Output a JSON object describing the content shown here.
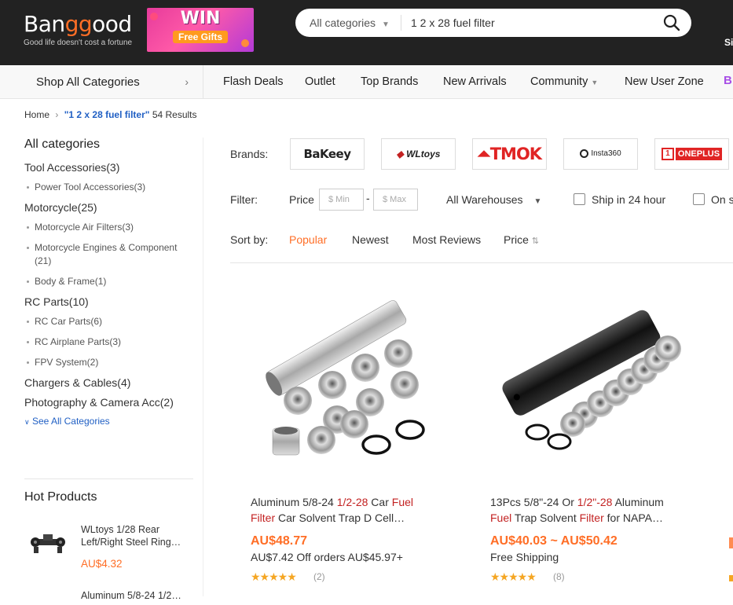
{
  "header": {
    "logo_text_a": "Ban",
    "logo_text_b": "gg",
    "logo_text_c": "ood",
    "logo_tagline": "Good life doesn't cost a fortune",
    "promo_win": "WIN",
    "promo_gifts": "Free Gifts",
    "search_category": "All categories",
    "search_query": "1 2 x 28 fuel filter",
    "sign_partial": "Si"
  },
  "nav": {
    "shop_all": "Shop All Categories",
    "links": [
      "Flash Deals",
      "Outlet",
      "Top Brands",
      "New Arrivals",
      "Community",
      "New User Zone"
    ],
    "partial": "B"
  },
  "breadcrumb": {
    "home": "Home",
    "query": "\"1 2 x 28 fuel filter\"",
    "count": "54 Results"
  },
  "sidebar": {
    "title": "All categories",
    "cat1": "Tool Accessories(3)",
    "cat1_sub1": "Power Tool Accessories(3)",
    "cat2": "Motorcycle(25)",
    "cat2_sub1": "Motorcycle Air Filters(3)",
    "cat2_sub2": "Motorcycle Engines & Component (21)",
    "cat2_sub3": "Body & Frame(1)",
    "cat3": "RC Parts(10)",
    "cat3_sub1": "RC Car Parts(6)",
    "cat3_sub2": "RC Airplane Parts(3)",
    "cat3_sub3": "FPV System(2)",
    "cat4": "Chargers & Cables(4)",
    "cat5": "Photography & Camera Acc(2)",
    "see_all": "See All Categories",
    "hot_title": "Hot Products",
    "hot1_name": "WLtoys 1/28 Rear Left/Right Steel Ring…",
    "hot1_price": "AU$4.32",
    "hot2_name": "Aluminum 5/8-24 1/2…"
  },
  "filters": {
    "brands_label": "Brands:",
    "brands": [
      "BaKeey",
      "WLtoys",
      "TMOK",
      "Insta360",
      "ONEPLUS"
    ],
    "filter_label": "Filter:",
    "price_label": "Price",
    "min_placeholder": "$ Min",
    "max_placeholder": "$ Max",
    "dash": "-",
    "warehouse": "All Warehouses",
    "ship24": "Ship in 24 hour",
    "onsale_partial": "On s",
    "sort_label": "Sort by:",
    "sort_options": [
      "Popular",
      "Newest",
      "Most Reviews",
      "Price"
    ]
  },
  "products": [
    {
      "title_a": "Aluminum 5/8-24 ",
      "title_hl1": "1/2-28",
      "title_b": " Car ",
      "title_hl2": "Fuel Filter",
      "title_c": " Car Solvent Trap D Cell…",
      "price": "AU$48.77",
      "promo": "AU$7.42 Off orders AU$45.97+",
      "stars": "★★★★★",
      "reviews": "(2)"
    },
    {
      "title_a": "13Pcs 5/8\"-24 Or ",
      "title_hl1": "1/2\"-28",
      "title_b": " Aluminum ",
      "title_hl2": "Fuel",
      "title_c": " Trap Solvent ",
      "title_hl3": "Filter",
      "title_d": " for NAPA…",
      "price": "AU$40.03 ~ AU$50.42",
      "promo": "Free Shipping",
      "stars": "★★★★★",
      "reviews": "(8)"
    }
  ],
  "colors": {
    "accent": "#ff6e26",
    "link": "#2160c4",
    "highlight": "#c32222",
    "topbar": "#222222"
  }
}
